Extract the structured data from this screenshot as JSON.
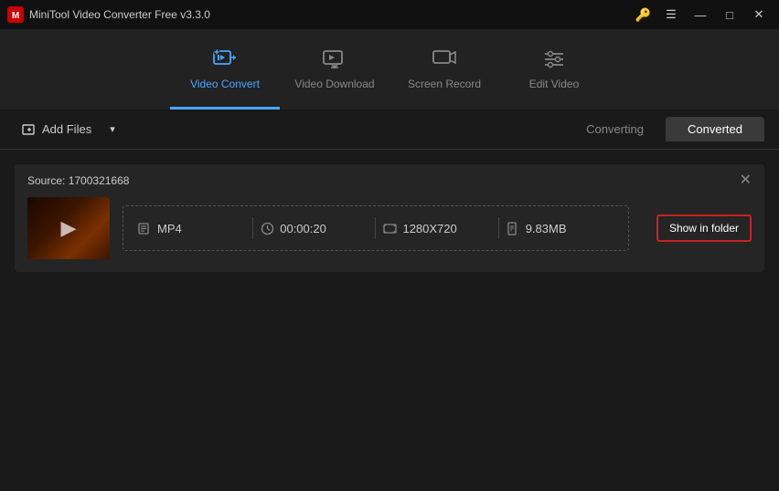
{
  "titleBar": {
    "appTitle": "MiniTool Video Converter Free v3.3.0",
    "keyIcon": "🔑"
  },
  "nav": {
    "items": [
      {
        "id": "video-convert",
        "label": "Video Convert",
        "active": true
      },
      {
        "id": "video-download",
        "label": "Video Download",
        "active": false
      },
      {
        "id": "screen-record",
        "label": "Screen Record",
        "active": false
      },
      {
        "id": "edit-video",
        "label": "Edit Video",
        "active": false
      }
    ]
  },
  "toolbar": {
    "addFilesLabel": "Add Files",
    "tabs": [
      {
        "id": "converting",
        "label": "Converting",
        "active": false
      },
      {
        "id": "converted",
        "label": "Converted",
        "active": true
      }
    ]
  },
  "convertedItem": {
    "sourceLabel": "Source:",
    "sourceValue": "1700321668",
    "format": "MP4",
    "duration": "00:00:20",
    "resolution": "1280X720",
    "fileSize": "9.83MB",
    "showInFolderLabel": "Show in folder"
  },
  "windowControls": {
    "minimize": "—",
    "maximize": "□",
    "close": "✕"
  }
}
